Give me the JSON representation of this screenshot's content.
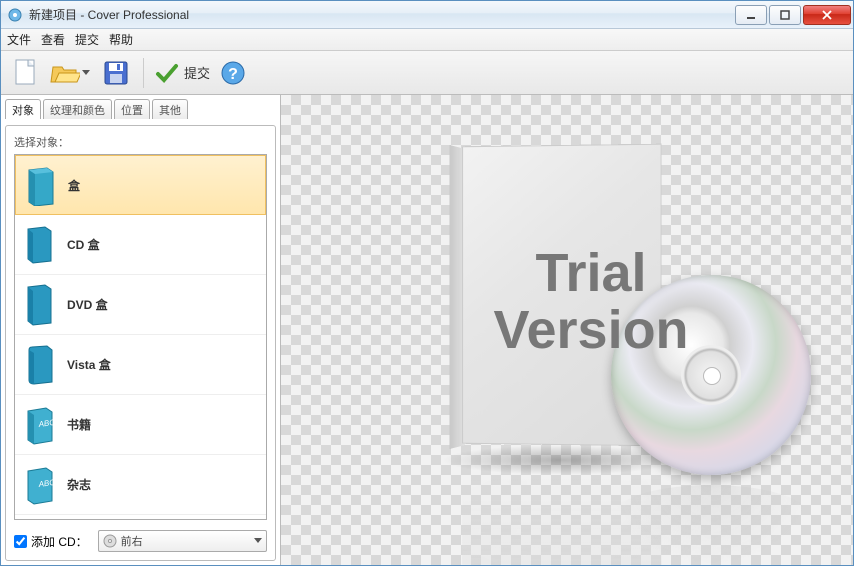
{
  "window": {
    "title": "新建项目 - Cover Professional"
  },
  "menu": {
    "file": "文件",
    "view": "查看",
    "submit": "提交",
    "help": "帮助"
  },
  "toolbar": {
    "submit_label": "提交"
  },
  "tabs": {
    "objects": "对象",
    "texture": "纹理和颜色",
    "position": "位置",
    "other": "其他"
  },
  "left": {
    "select_label": "选择对象：",
    "items": [
      {
        "label": "盒"
      },
      {
        "label": "CD 盒"
      },
      {
        "label": "DVD 盒"
      },
      {
        "label": "Vista 盒"
      },
      {
        "label": "书籍"
      },
      {
        "label": "杂志"
      }
    ],
    "add_cd_label": "添加 CD：",
    "cd_position": "前右"
  },
  "preview": {
    "watermark_l1": "Trial",
    "watermark_l2": "Version"
  }
}
